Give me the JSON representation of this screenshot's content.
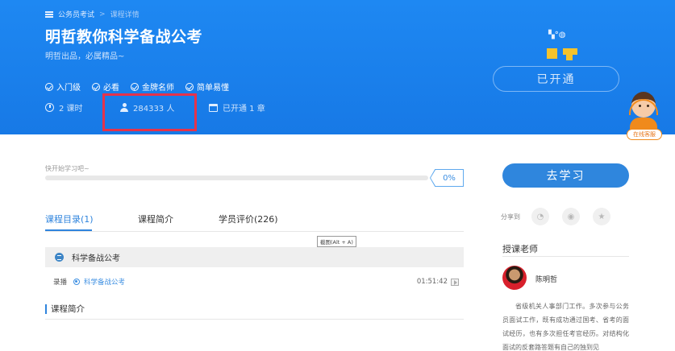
{
  "header": {
    "breadcrumb": {
      "parent": "公务员考试",
      "separator": ">",
      "current": "课程详情"
    },
    "course_title": "明哲教你科学备战公考",
    "course_subtitle": "明哲出品，必属精品~",
    "tags": [
      "入门级",
      "必看",
      "金牌名师",
      "简单易懂"
    ],
    "meta": {
      "lessons": "2 课时",
      "students": "284333 人",
      "progress": "已开通  1 章"
    },
    "opened_label": "已开通",
    "service_label": "在线客服"
  },
  "progress": {
    "caption": "快开始学习吧~",
    "percent_label": "0%",
    "fraction": 0
  },
  "tabs": [
    {
      "label": "课程目录(1)",
      "active": true
    },
    {
      "label": "课程简介",
      "active": false
    },
    {
      "label": "学员评价(226)",
      "active": false
    }
  ],
  "tooltip": "截图(Alt + A)",
  "chapter": {
    "title": "科学备战公考"
  },
  "lesson": {
    "type": "录播",
    "name": "科学备战公考",
    "duration": "01:51:42"
  },
  "intro_heading": "课程简介",
  "sidebar": {
    "study_button": "去学习",
    "share_label": "分享到",
    "share_icons": [
      "wechat-icon",
      "weibo-icon",
      "star-icon"
    ],
    "teacher_heading": "授课老师",
    "teacher_name": "陈明哲",
    "teacher_bio": "省级机关人事部门工作。多次参与公务员面试工作，既有成功通过国考、省考的面试经历，也有多次担任考官经历。对结构化面试的反套路答题有自己的独到见"
  },
  "colors": {
    "brand_blue": "#1e88f2",
    "accent": "#2f84dd",
    "highlight_red": "#e5334b",
    "logo_yellow": "#f5c32c"
  }
}
